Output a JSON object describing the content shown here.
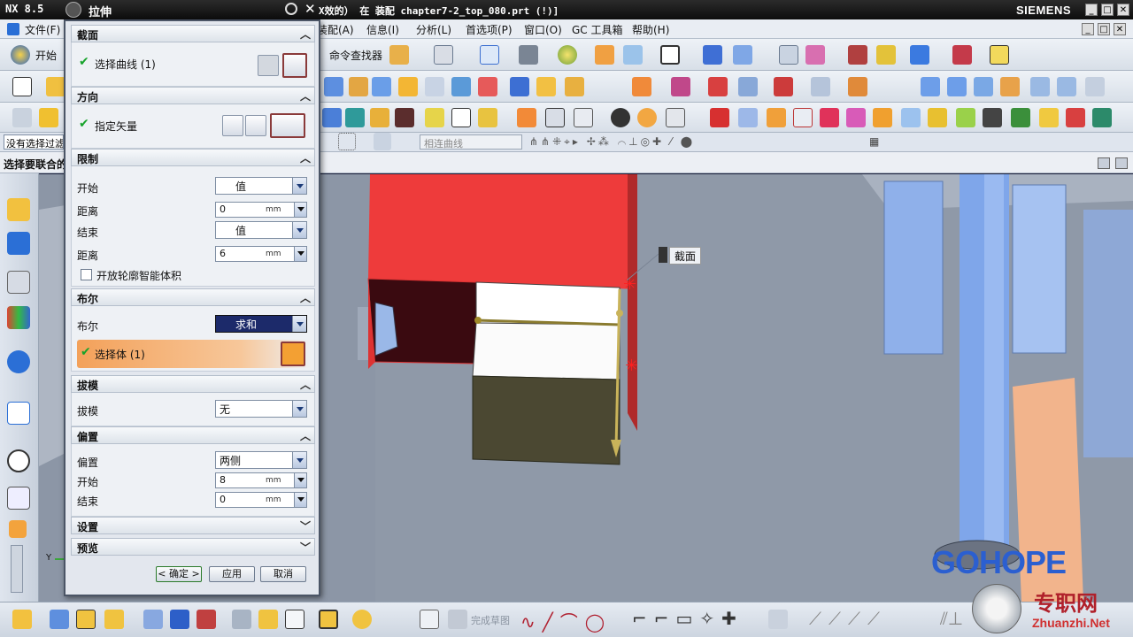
{
  "titlebar": {
    "app": "NX 8.5",
    "dialog_title": "拉伸",
    "file_title": "X效的） 在 装配 chapter7-2_top_080.prt   (!)]",
    "brand": "SIEMENS"
  },
  "menu": {
    "file": "文件(F)",
    "start": "开始",
    "assembly": "装配(A)",
    "info": "信息(I)",
    "analysis": "分析(L)",
    "preferences": "首选项(P)",
    "window": "窗口(O)",
    "gc_toolbox": "GC 工具箱",
    "help": "帮助(H)",
    "command_finder": "命令查找器"
  },
  "selection": {
    "no_filter": "没有选择过滤",
    "select_assoc": "选择要联合的",
    "curve_rule": "相连曲线"
  },
  "dialog": {
    "section": {
      "title": "截面",
      "select_curve": "选择曲线 (1)"
    },
    "direction": {
      "title": "方向",
      "specify_vector": "指定矢量"
    },
    "limits": {
      "title": "限制",
      "start_label": "开始",
      "start_value": "值",
      "distance1_label": "距离",
      "distance1_value": "0",
      "end_label": "结束",
      "end_value": "值",
      "distance2_label": "距离",
      "distance2_value": "6",
      "unit": "mm",
      "open_profile": "开放轮廓智能体积"
    },
    "boolean": {
      "title": "布尔",
      "label": "布尔",
      "value": "求和",
      "select_body": "选择体 (1)"
    },
    "draft": {
      "title": "拔模",
      "label": "拔模",
      "value": "无"
    },
    "offset": {
      "title": "偏置",
      "label": "偏置",
      "value": "两侧",
      "start_label": "开始",
      "start_value": "8",
      "end_label": "结束",
      "end_value": "0",
      "unit": "mm"
    },
    "settings": {
      "title": "设置"
    },
    "preview": {
      "title": "预览"
    },
    "buttons": {
      "ok": "< 确定 >",
      "apply": "应用",
      "cancel": "取消"
    }
  },
  "viewport": {
    "section_tag": "截面"
  },
  "bottombar": {
    "finish_sketch": "完成草图"
  },
  "watermark": {
    "logo": "GOHOPE",
    "cn": "专职网",
    "url": "Zhuanzhi.Net"
  }
}
